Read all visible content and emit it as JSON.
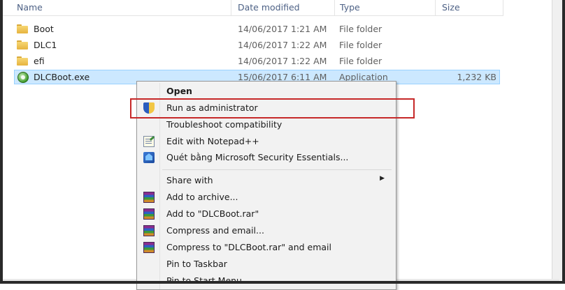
{
  "columns": {
    "name": "Name",
    "date_modified": "Date modified",
    "type": "Type",
    "size": "Size"
  },
  "files": [
    {
      "name": "Boot",
      "date": "14/06/2017 1:21 AM",
      "type": "File folder",
      "size": "",
      "icon": "folder-icon"
    },
    {
      "name": "DLC1",
      "date": "14/06/2017 1:22 AM",
      "type": "File folder",
      "size": "",
      "icon": "folder-icon"
    },
    {
      "name": "efi",
      "date": "14/06/2017 1:22 AM",
      "type": "File folder",
      "size": "",
      "icon": "folder-icon"
    },
    {
      "name": "DLCBoot.exe",
      "date": "15/06/2017 6:11 AM",
      "type": "Application",
      "size": "1,232 KB",
      "icon": "app-icon"
    }
  ],
  "context_menu": {
    "items": [
      {
        "label": "Open",
        "bold": true,
        "icon": ""
      },
      {
        "label": "Run as administrator",
        "icon": "shield-icon"
      },
      {
        "label": "Troubleshoot compatibility",
        "icon": ""
      },
      {
        "label": "Edit with Notepad++",
        "icon": "notepad-icon"
      },
      {
        "label": "Quét bằng Microsoft Security Essentials...",
        "icon": "security-essentials-icon"
      },
      {
        "label": "Share with",
        "icon": "",
        "submenu": true
      },
      {
        "label": "Add to archive...",
        "icon": "winrar-icon"
      },
      {
        "label": "Add to \"DLCBoot.rar\"",
        "icon": "winrar-icon"
      },
      {
        "label": "Compress and email...",
        "icon": "winrar-icon"
      },
      {
        "label": "Compress to \"DLCBoot.rar\" and email",
        "icon": "winrar-icon"
      },
      {
        "label": "Pin to Taskbar",
        "icon": ""
      },
      {
        "label": "Pin to Start Menu",
        "icon": ""
      }
    ]
  },
  "colors": {
    "selection": "#cce8ff",
    "highlight_box": "#c62828"
  }
}
